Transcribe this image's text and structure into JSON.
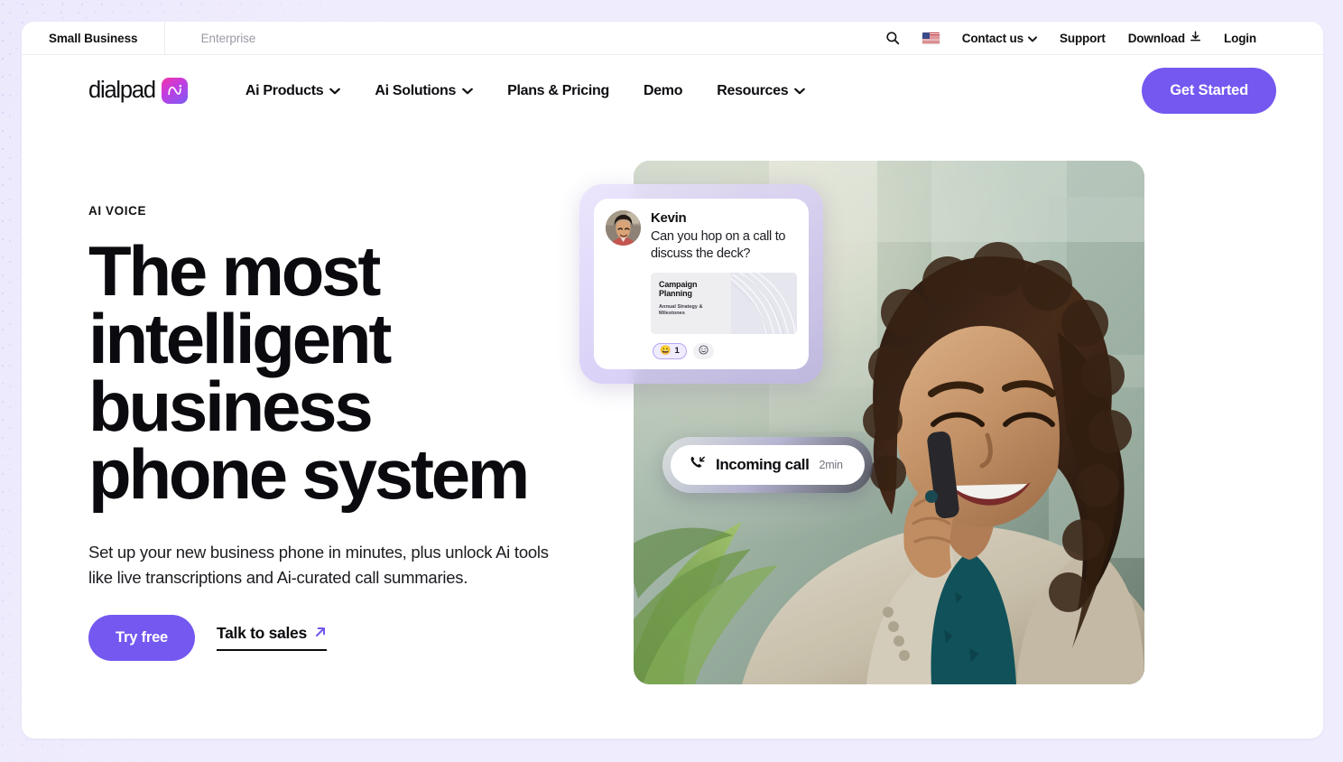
{
  "utility_bar": {
    "tabs": [
      {
        "label": "Small Business",
        "active": true
      },
      {
        "label": "Enterprise",
        "active": false
      }
    ],
    "search_icon": "search-icon",
    "locale_flag": "us-flag-icon",
    "links": [
      {
        "label": "Contact us",
        "has_caret": true
      },
      {
        "label": "Support",
        "has_caret": false
      },
      {
        "label": "Download",
        "has_caret": false,
        "icon": "download-icon"
      },
      {
        "label": "Login",
        "has_caret": false
      }
    ]
  },
  "main_nav": {
    "brand": {
      "wordmark": "dialpad",
      "badge_icon": "dialpad-ai-mark"
    },
    "links": [
      {
        "label": "Ai Products",
        "has_caret": true
      },
      {
        "label": "Ai Solutions",
        "has_caret": true
      },
      {
        "label": "Plans & Pricing",
        "has_caret": false
      },
      {
        "label": "Demo",
        "has_caret": false
      },
      {
        "label": "Resources",
        "has_caret": true
      }
    ],
    "cta": "Get Started"
  },
  "hero": {
    "eyebrow": "AI VOICE",
    "title": "The most intelligent business phone system",
    "subtitle": "Set up your new business phone in minutes, plus unlock Ai tools like live transcriptions and Ai-curated call summaries.",
    "primary_cta": "Try free",
    "secondary_cta": "Talk to sales",
    "secondary_cta_icon": "arrow-up-right-icon"
  },
  "chat_card": {
    "sender": "Kevin",
    "message": "Can you hop on a call to discuss the deck?",
    "attachment": {
      "title": "Campaign Planning",
      "subtitle": "Annual Strategy & Milestones"
    },
    "reactions": [
      {
        "emoji": "😀",
        "count": "1",
        "name": "grinning-reaction"
      },
      {
        "emoji": "☺",
        "count": "",
        "name": "add-reaction"
      }
    ]
  },
  "call_notification": {
    "icon": "incoming-call-icon",
    "label": "Incoming call",
    "duration": "2min"
  },
  "colors": {
    "brand_purple": "#7458F0",
    "backdrop": "#EDE9FD",
    "card": "#FFFFFF",
    "text": "#0B0B0F",
    "muted": "#9A9AA4"
  }
}
